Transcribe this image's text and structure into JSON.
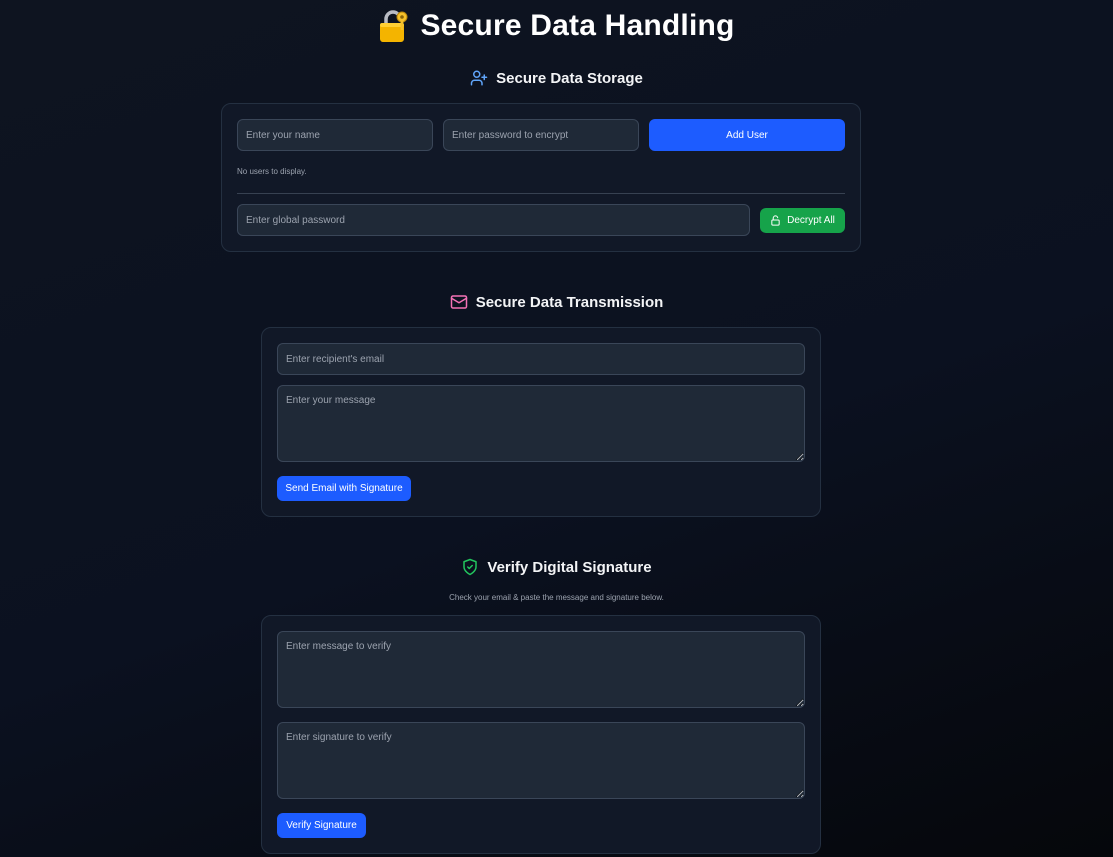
{
  "header": {
    "title": "Secure Data Handling",
    "icon": "lock-with-key-emoji"
  },
  "storage": {
    "heading": "Secure Data Storage",
    "icon": "user-plus-icon",
    "icon_color": "#60a5fa",
    "name_placeholder": "Enter your name",
    "password_placeholder": "Enter password to encrypt",
    "add_user_label": "Add User",
    "empty_text": "No users to display.",
    "global_password_placeholder": "Enter global password",
    "decrypt_all_label": "Decrypt All",
    "decrypt_icon": "unlock-icon"
  },
  "transmission": {
    "heading": "Secure Data Transmission",
    "icon": "mail-icon",
    "icon_color": "#f472b6",
    "email_placeholder": "Enter recipient's email",
    "message_placeholder": "Enter your message",
    "send_label": "Send Email with Signature"
  },
  "verify": {
    "heading": "Verify Digital Signature",
    "icon": "shield-check-icon",
    "icon_color": "#22c55e",
    "instructions": "Check your email & paste the message and signature below.",
    "message_placeholder": "Enter message to verify",
    "signature_placeholder": "Enter signature to verify",
    "verify_label": "Verify Signature"
  },
  "colors": {
    "primary_button": "#1d5cff",
    "success_button": "#16a34a",
    "card_background": "#111827",
    "field_background": "#1f2937"
  }
}
